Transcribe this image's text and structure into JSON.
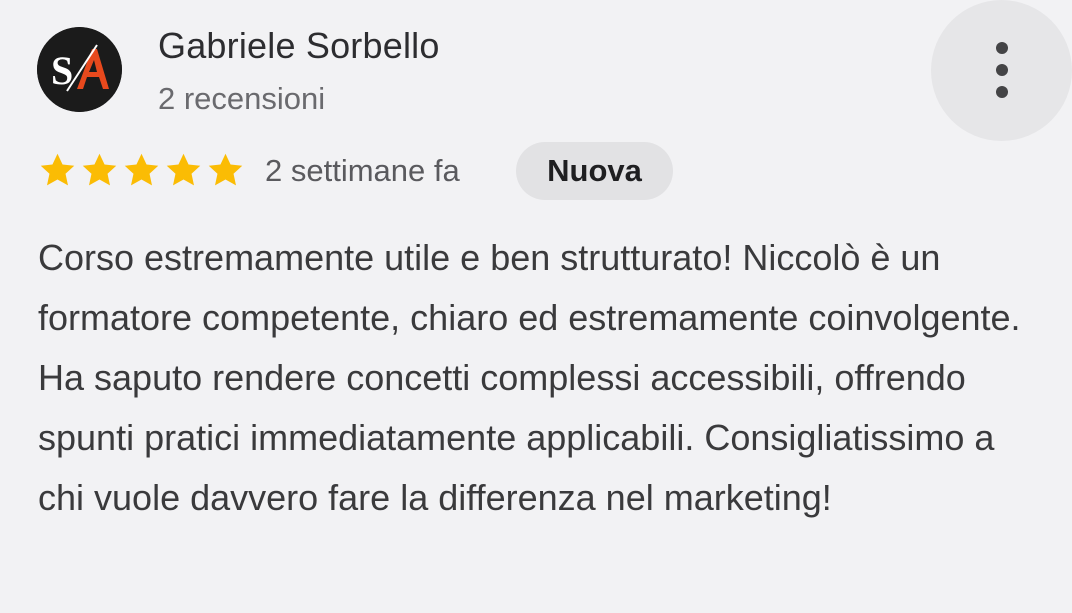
{
  "review": {
    "author_name": "Gabriele Sorbello",
    "author_reviews": "2 recensioni",
    "avatar_initials": "SA",
    "rating": 5,
    "rating_max": 5,
    "time_ago": "2 settimane fa",
    "badge": "Nuova",
    "text": "Corso estremamente utile e ben strutturato! Niccolò è un formatore competente, chiaro ed estremamente coinvolgente. Ha saputo rendere concetti complessi accessibili, offrendo spunti pratici immediatamente applicabili. Consigliatissimo a chi vuole davvero fare la differenza nel marketing!"
  },
  "icons": {
    "star": "star-icon",
    "more": "more-vert-icon",
    "avatar": "avatar-logo"
  },
  "colors": {
    "star": "#fbbc04",
    "background": "#f2f2f4",
    "badge_bg": "#e2e2e4",
    "avatar_bg": "#1b1b1b",
    "avatar_accent": "#e8491d"
  }
}
